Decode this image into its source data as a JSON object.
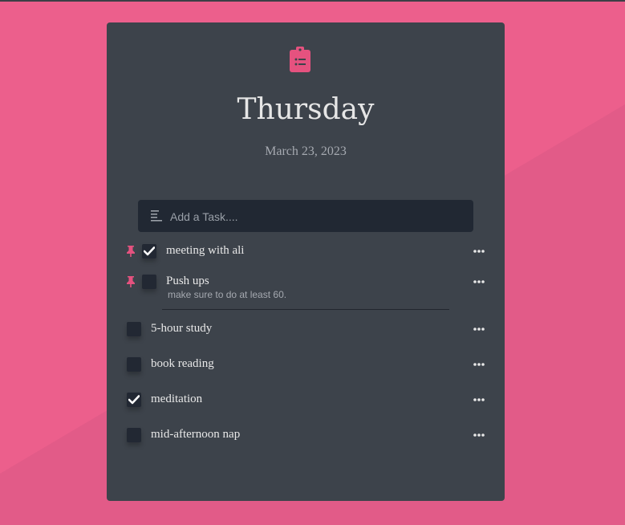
{
  "app": {
    "day": "Thursday",
    "date": "March 23, 2023"
  },
  "add_task": {
    "placeholder": "Add a Task...."
  },
  "colors": {
    "background": "#ec5f8c",
    "card": "#3d434b",
    "accent": "#e5527f",
    "input_bg": "#212833"
  },
  "icons": {
    "logo": "clipboard-list-icon",
    "add": "align-left-icon",
    "pin": "pin-icon",
    "more": "more-horizontal-icon",
    "check": "check-icon"
  },
  "tasks": [
    {
      "label": "meeting with ali",
      "pinned": true,
      "checked": true,
      "note": ""
    },
    {
      "label": "Push ups",
      "pinned": true,
      "checked": false,
      "note": "make sure to do at least 60."
    },
    {
      "label": "5-hour study",
      "pinned": false,
      "checked": false,
      "note": ""
    },
    {
      "label": "book reading",
      "pinned": false,
      "checked": false,
      "note": ""
    },
    {
      "label": "meditation",
      "pinned": false,
      "checked": true,
      "note": ""
    },
    {
      "label": "mid-afternoon nap",
      "pinned": false,
      "checked": false,
      "note": ""
    }
  ]
}
